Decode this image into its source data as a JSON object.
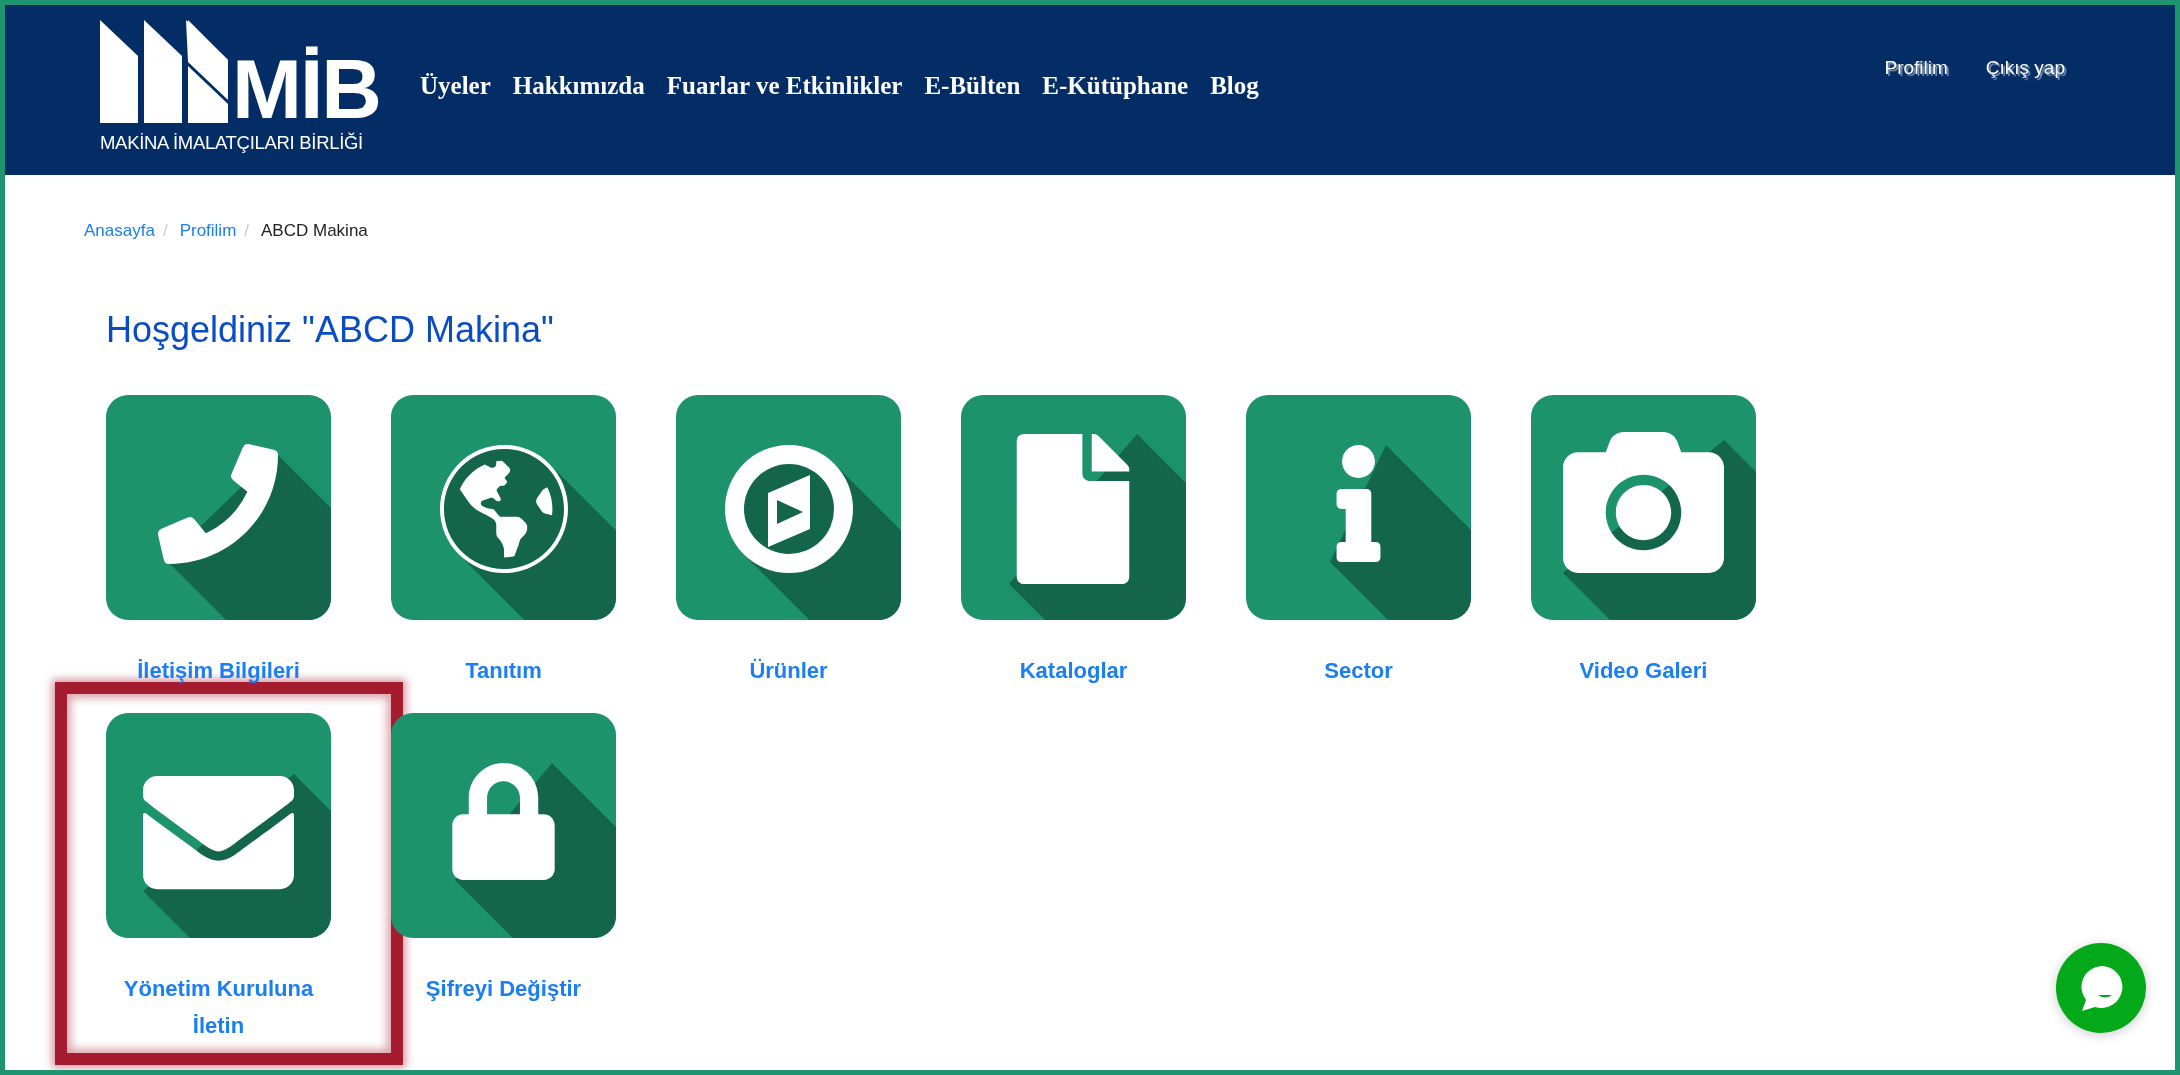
{
  "header": {
    "logo": {
      "mark": "MİB",
      "subtitle": "MAKİNA İMALATÇILARI BİRLİĞİ"
    },
    "nav": [
      "Üyeler",
      "Hakkımızda",
      "Fuarlar ve Etkinlikler",
      "E-Bülten",
      "E-Kütüphane",
      "Blog"
    ],
    "user_links": [
      "Profilim",
      "Çıkış yap"
    ]
  },
  "breadcrumb": {
    "items": [
      {
        "label": "Anasayfa",
        "current": false
      },
      {
        "label": "Profilim",
        "current": false
      },
      {
        "label": "ABCD Makina",
        "current": true
      }
    ],
    "separators": [
      "/",
      "/"
    ]
  },
  "heading": "Hoşgeldiniz \"ABCD Makina\"",
  "tiles": [
    {
      "label": "İletişim Bilgileri",
      "kind": "phone",
      "highlighted": false
    },
    {
      "label": "Tanıtım",
      "kind": "globe",
      "highlighted": false
    },
    {
      "label": "Ürünler",
      "kind": "play",
      "highlighted": false
    },
    {
      "label": "Kataloglar",
      "kind": "document",
      "highlighted": false
    },
    {
      "label": "Sector",
      "kind": "info",
      "highlighted": false
    },
    {
      "label": "Video Galeri",
      "kind": "camera",
      "highlighted": false
    },
    {
      "label": "Yönetim Kuruluna İletin",
      "kind": "mail",
      "highlighted": true
    },
    {
      "label": "Şifreyi Değiştir",
      "kind": "lock",
      "highlighted": false
    }
  ]
}
